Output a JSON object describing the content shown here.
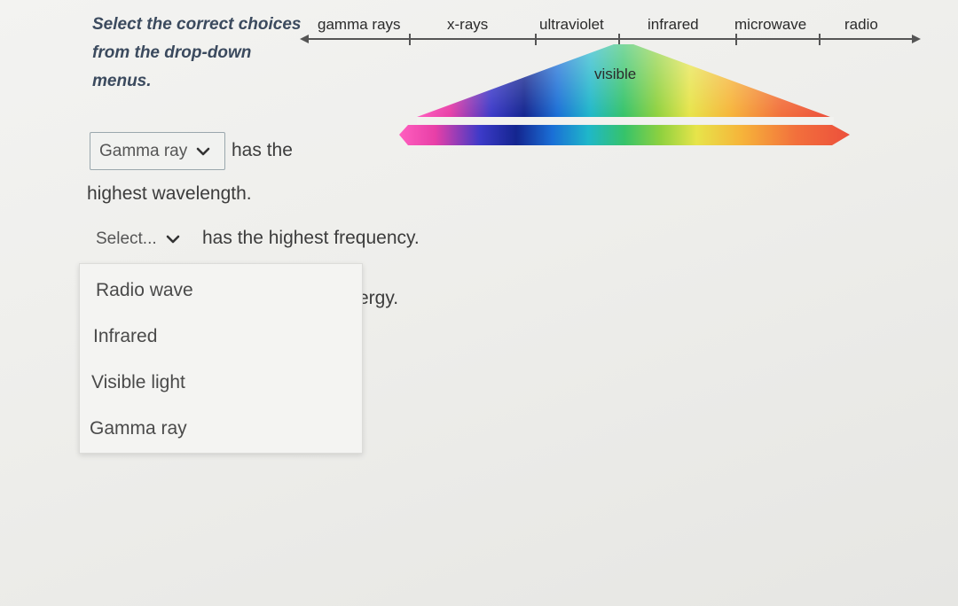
{
  "instructions": "Select the correct choices from the drop-down menus.",
  "spectrum": {
    "labels": [
      "gamma rays",
      "x-rays",
      "ultraviolet",
      "infrared",
      "microwave",
      "radio"
    ],
    "visible_label": "visible"
  },
  "question1": {
    "selected": "Gamma ray",
    "text_after": "has the",
    "text_line2": "highest wavelength."
  },
  "question2": {
    "placeholder": "Select...",
    "text_after": "has the highest frequency."
  },
  "question3": {
    "partial_text": "ergy."
  },
  "dropdown_menu": {
    "options": [
      "Radio wave",
      "Infrared",
      "Visible light",
      "Gamma ray"
    ]
  }
}
